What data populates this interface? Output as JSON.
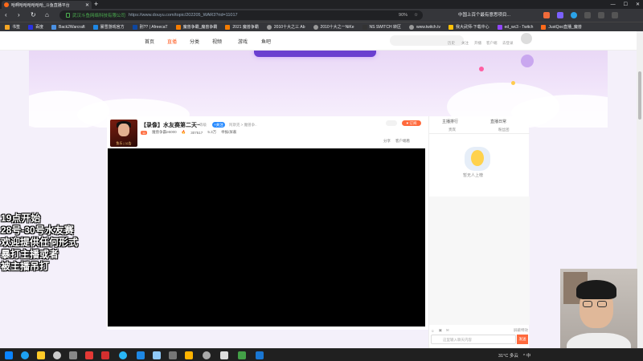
{
  "browser": {
    "tab_title": "哈啊哈哈哈哈哈哈_斗鱼直播平台",
    "tab_close": "✕",
    "new_tab": "+",
    "window_controls": [
      "—",
      "☐",
      "✕"
    ],
    "nav": {
      "back": "‹",
      "forward": "›",
      "reload": "↻",
      "home": "⌂"
    },
    "site_name": "武汉斗鱼网络科技有限公司",
    "url": "https://www.douyu.com/topic/202205_WAR3?rid=11017",
    "zoom": "90%",
    "bookmark_star": "☆",
    "search_hint": "中国上百个最有意思项目...",
    "bookmarks": [
      "书签",
      "百度",
      "Back2Warcraft",
      "暴雪游戏官方",
      "别?? | AfreecaT",
      "魔兽争霸_魔兽争霸",
      "2021 魔兽争霸",
      "2010十大之三 Ab",
      "2010十大之一NiKe",
      "NS SWITCH 转区",
      "www.twitch.tv",
      "我大武师-下载中心",
      "ed_wc3 - Twitch",
      "JustQoo直播_魔兽"
    ]
  },
  "site": {
    "nav_items": [
      "首页",
      "直播",
      "分类",
      "视频",
      "游戏",
      "鱼吧"
    ],
    "active_index": 1,
    "right_links": [
      "历史",
      "关注",
      "开播",
      "客户端",
      "去登录"
    ]
  },
  "room": {
    "title": "【录像】水友赛第二天~",
    "tag": "等级",
    "follow_label": "+关注",
    "category": "阿斯克 > 魔兽争..",
    "avatar_label": "鱼乐 | 公告",
    "level": "11",
    "streamer": "魔兽争霸e6000",
    "heat": "307517",
    "fans": "5.3万",
    "report": "举报/屏蔽",
    "subscribe_label": "♥ 订阅",
    "share": "分享",
    "client": "客户端看"
  },
  "side_panel": {
    "tabs": [
      "主播排行",
      "直播日常"
    ],
    "subtabs": [
      "贵宾",
      "粉丝团"
    ],
    "empty_hint": "暂无人上榜",
    "chat_placeholder": "这里输入聊天内容",
    "send_label": "发送",
    "block_effects": "屏蔽特效"
  },
  "overlay_lines": [
    "19点开始",
    "28号-30号水友赛",
    "欢迎提供任何形式",
    "暴打主播或者",
    "被主播吊打"
  ],
  "taskbar": {
    "weather": "31°C 多云",
    "clock_time": "",
    "ime": "^ 中"
  },
  "colors": {
    "accent": "#ff5d23",
    "banner": "#e9d8f6",
    "chrome_dark": "#202124",
    "chrome_mid": "#35363a"
  }
}
